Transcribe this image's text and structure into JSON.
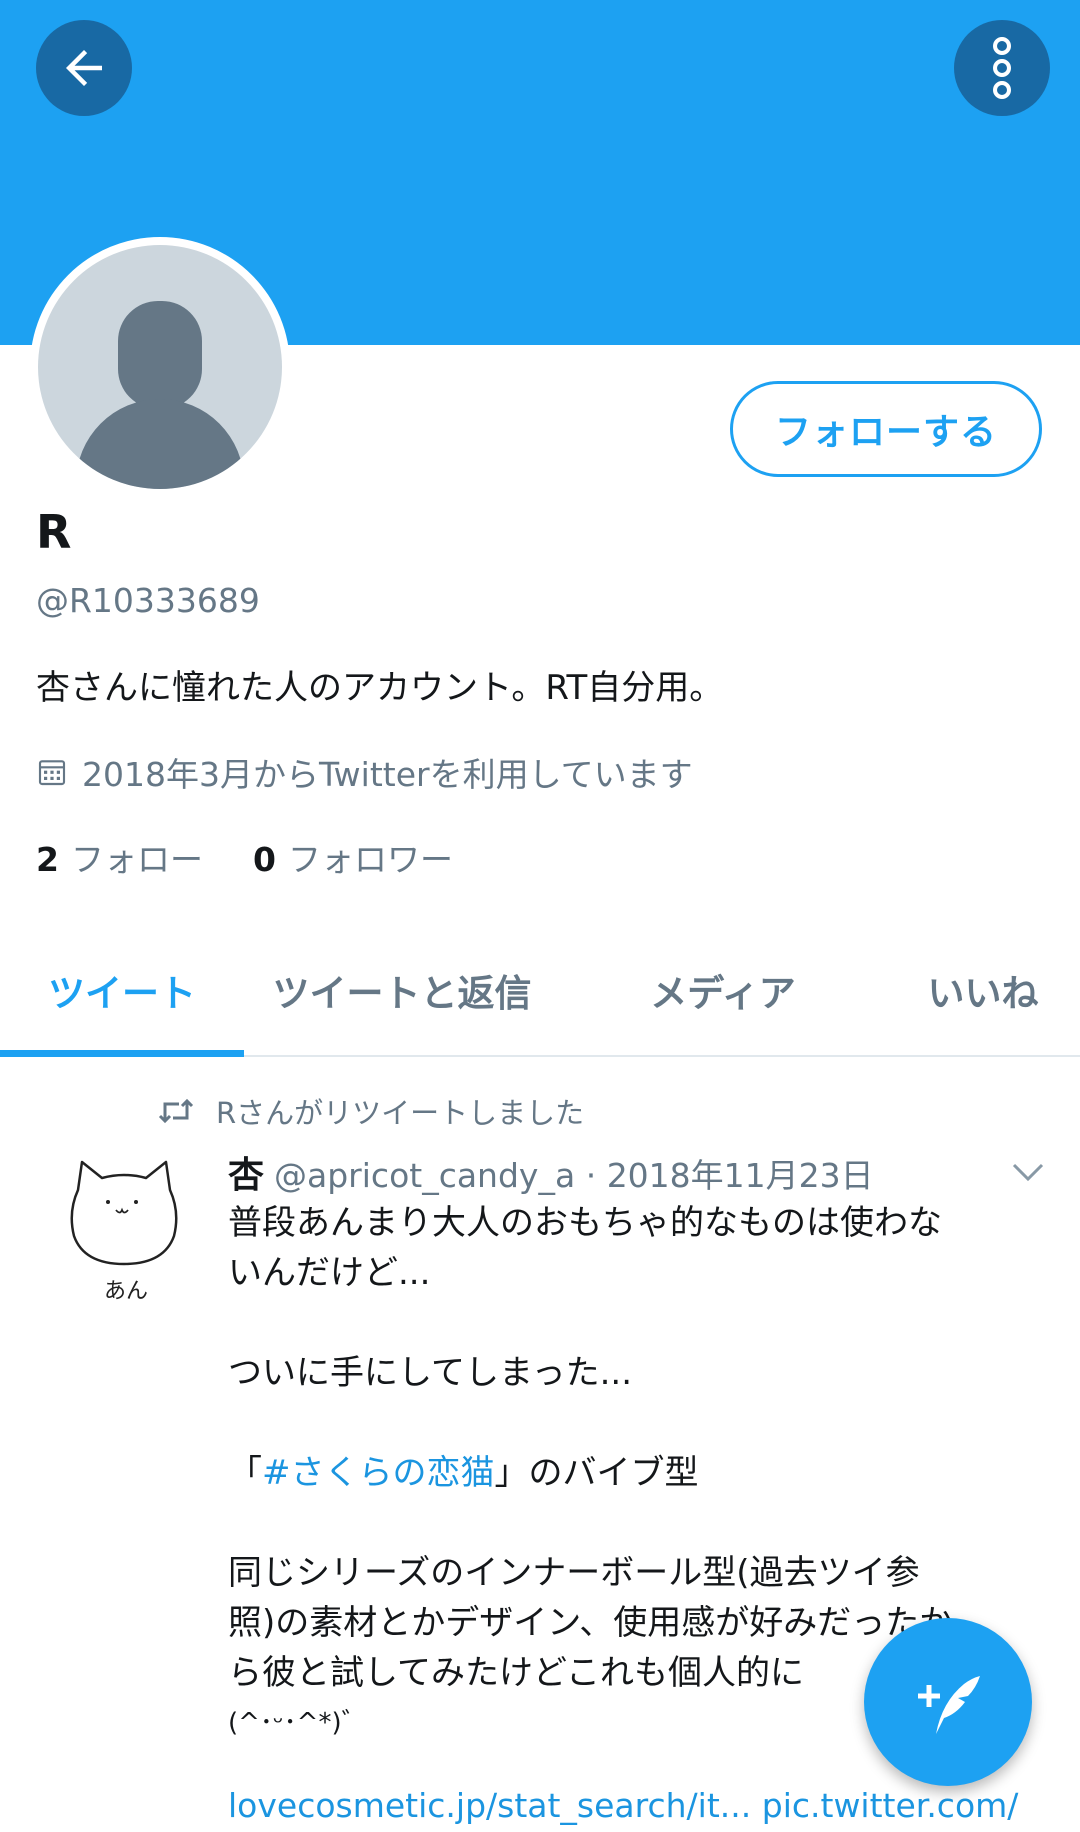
{
  "header": {
    "back_icon": "arrow-left-icon",
    "more_icon": "more-vertical-icon",
    "banner_color": "#1da1f2"
  },
  "profile": {
    "name": "R",
    "handle": "@R10333689",
    "bio": "杏さんに憧れた人のアカウント。RT自分用。",
    "joined": "2018年3月からTwitterを利用しています",
    "follow_button": "フォローする",
    "following_count": "2",
    "following_label": "フォロー",
    "followers_count": "0",
    "followers_label": "フォロワー"
  },
  "tabs": [
    {
      "label": "ツイート",
      "active": true
    },
    {
      "label": "ツイートと返信",
      "active": false
    },
    {
      "label": "メディア",
      "active": false
    },
    {
      "label": "いいね",
      "active": false
    }
  ],
  "tweet": {
    "retweet_text": "Rさんがリツイートしました",
    "author_name": "杏",
    "author_handle": "@apricot_candy_a",
    "separator": "·",
    "date": "2018年11月23日",
    "avatar_text": "あん",
    "line1": "普段あんまり大人のおもちゃ的なものは使わな",
    "line2": "いんだけど...",
    "line3": "ついに手にしてしまった...",
    "line4_prefix": "「",
    "hashtag": "#さくらの恋猫",
    "line4_suffix": "」のバイブ型",
    "line5": "同じシリーズのインナーボール型(過去ツイ参",
    "line6": "照)の素材とかデザイン、使用感が好みだったか",
    "line7": "ら彼と試してみたけどこれも個人的に",
    "line8": "(^･ᵕ･^*)゛",
    "link1": "lovecosmetic.jp/stat_search/it...",
    "link2": "pic.twitter.com/"
  },
  "fab": {
    "icon": "compose-tweet-icon"
  },
  "colors": {
    "accent": "#1da1f2",
    "secondary_text": "#657786",
    "link": "#1b95e0"
  }
}
